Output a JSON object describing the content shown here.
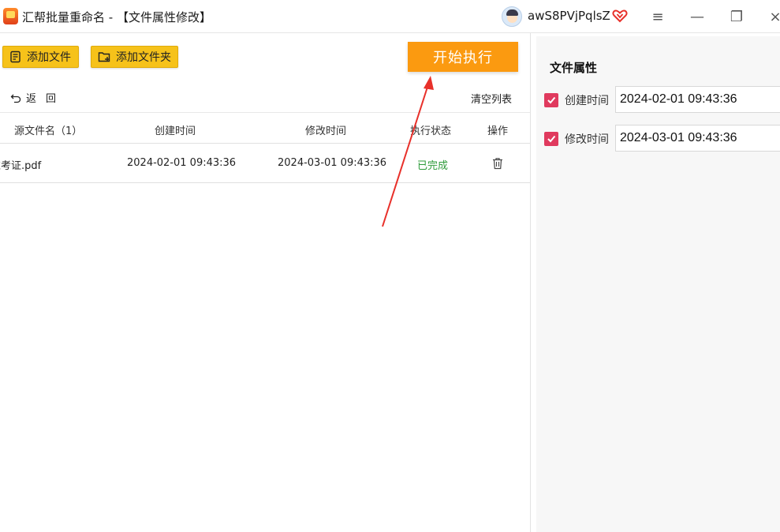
{
  "window": {
    "title": "汇帮批量重命名 - 【文件属性修改】",
    "username": "awS8PVjPqlsZ",
    "controls": {
      "menu": "≡",
      "minimize": "—",
      "maximize": "❐",
      "close": "×"
    }
  },
  "toolbar": {
    "add_file": "添加文件",
    "add_folder": "添加文件夹",
    "start": "开始执行",
    "back": "返回",
    "clear_list": "清空列表"
  },
  "table": {
    "headers": {
      "name": "源文件名（1）",
      "created": "创建时间",
      "modified": "修改时间",
      "status": "执行状态",
      "action": "操作"
    },
    "rows": [
      {
        "name": "准考证.pdf",
        "created": "2024-02-01 09:43:36",
        "modified": "2024-03-01 09:43:36",
        "status": "已完成"
      }
    ]
  },
  "properties": {
    "title": "文件属性",
    "created": {
      "label": "创建时间",
      "checked": true,
      "value": "2024-02-01 09:43:36"
    },
    "modified": {
      "label": "修改时间",
      "checked": true,
      "value": "2024-03-01 09:43:36"
    }
  },
  "colors": {
    "toolbar_button": "#f6c21a",
    "start_button": "#fb9a10",
    "status_done": "#2e9b3a",
    "checkbox": "#e03a5e",
    "annotation_arrow": "#e8302a"
  },
  "icons": [
    "app-logo-icon",
    "user-avatar-icon",
    "vip-heart-icon",
    "menu-icon",
    "minimize-icon",
    "maximize-icon",
    "close-icon",
    "add-file-icon",
    "add-folder-icon",
    "back-arrow-icon",
    "trash-icon",
    "checkbox-check-icon"
  ]
}
